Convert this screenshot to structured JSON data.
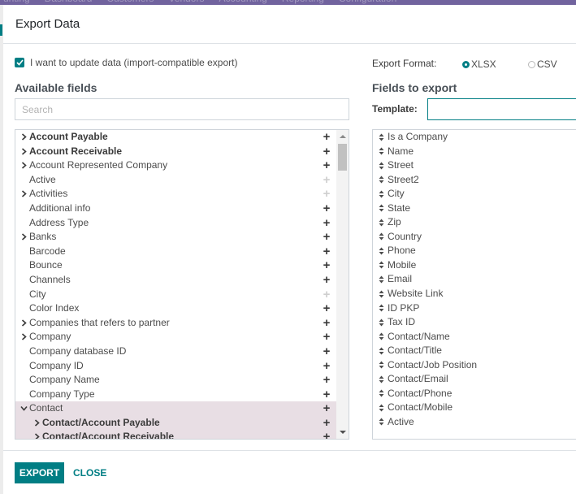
{
  "background_menu": [
    "unting",
    "Dashboard",
    "Customers",
    "Vendors",
    "Accounting",
    "Reporting",
    "Configuration"
  ],
  "dialog": {
    "title": "Export Data",
    "import_compatible": {
      "checked": true,
      "label": "I want to update data (import-compatible export)"
    },
    "available_title": "Available fields",
    "search_placeholder": "Search",
    "export_format_label": "Export Format:",
    "formats": [
      {
        "label": "XLSX",
        "selected": true
      },
      {
        "label": "CSV",
        "selected": false
      }
    ],
    "fields_to_export_title": "Fields to export",
    "template_label": "Template:",
    "template_value": "",
    "export_button": "EXPORT",
    "close_button": "CLOSE"
  },
  "available_fields": [
    {
      "label": "Account Payable",
      "expandable": true,
      "bold": true
    },
    {
      "label": "Account Receivable",
      "expandable": true,
      "bold": true
    },
    {
      "label": "Account Represented Company",
      "expandable": true
    },
    {
      "label": "Active",
      "added": true
    },
    {
      "label": "Activities",
      "expandable": true,
      "added": true
    },
    {
      "label": "Additional info"
    },
    {
      "label": "Address Type"
    },
    {
      "label": "Banks",
      "expandable": true
    },
    {
      "label": "Barcode"
    },
    {
      "label": "Bounce"
    },
    {
      "label": "Channels"
    },
    {
      "label": "City",
      "added": true
    },
    {
      "label": "Color Index"
    },
    {
      "label": "Companies that refers to partner",
      "expandable": true
    },
    {
      "label": "Company",
      "expandable": true
    },
    {
      "label": "Company database ID"
    },
    {
      "label": "Company ID"
    },
    {
      "label": "Company Name"
    },
    {
      "label": "Company Type"
    },
    {
      "label": "Contact",
      "expanded": true,
      "highlight": true
    },
    {
      "label": "Contact/Account Payable",
      "expandable": true,
      "bold": true,
      "sub": true,
      "highlight": true
    },
    {
      "label": "Contact/Account Receivable",
      "expandable": true,
      "bold": true,
      "sub": true,
      "highlight": true
    }
  ],
  "export_fields": [
    "Is a Company",
    "Name",
    "Street",
    "Street2",
    "City",
    "State",
    "Zip",
    "Country",
    "Phone",
    "Mobile",
    "Email",
    "Website Link",
    "ID PKP",
    "Tax ID",
    "Contact/Name",
    "Contact/Title",
    "Contact/Job Position",
    "Contact/Email",
    "Contact/Phone",
    "Contact/Mobile",
    "Active"
  ],
  "colors": {
    "accent": "#017e84",
    "highlight_row": "#e8dee4"
  }
}
